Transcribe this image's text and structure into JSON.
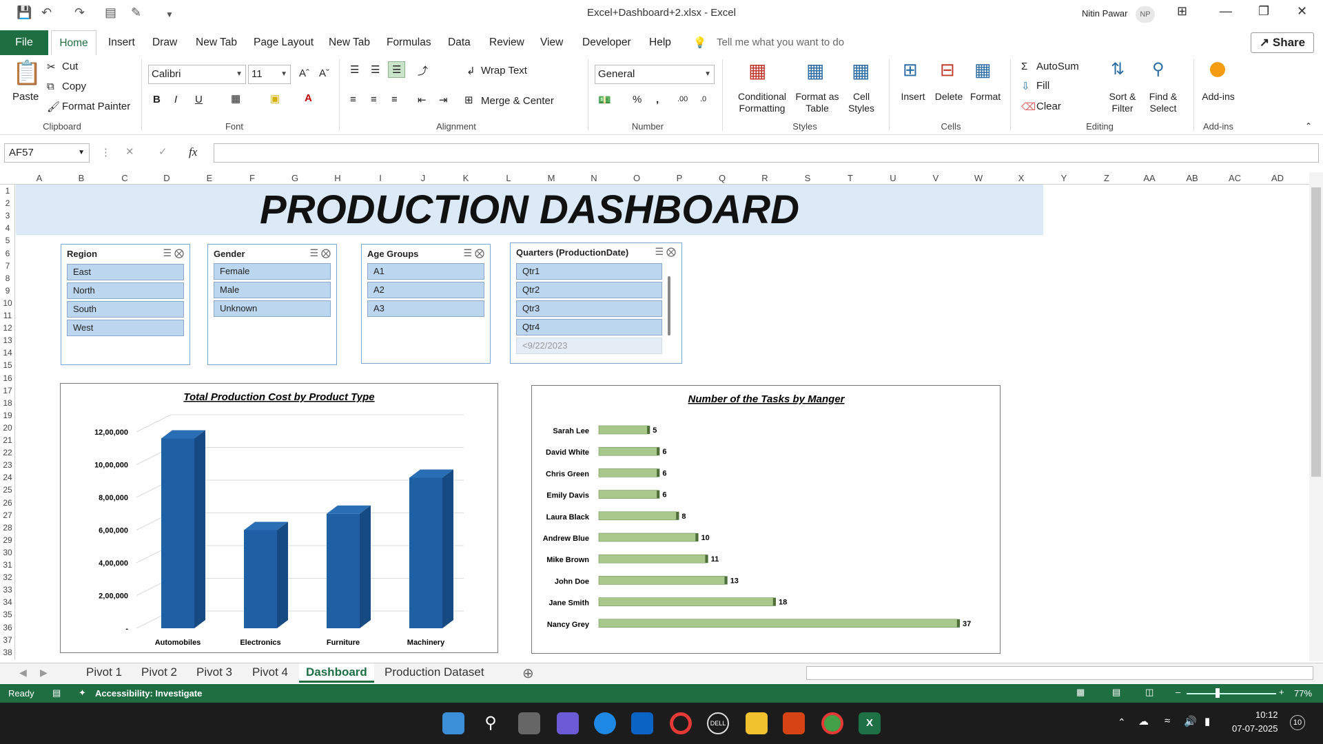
{
  "window": {
    "title": "Excel+Dashboard+2.xlsx  -  Excel",
    "user_name": "Nitin Pawar",
    "user_initials": "NP"
  },
  "tabs": {
    "file": "File",
    "items": [
      "Home",
      "Insert",
      "Draw",
      "New Tab",
      "Page Layout",
      "New Tab",
      "Formulas",
      "Data",
      "Review",
      "View",
      "Developer",
      "Help"
    ],
    "tell_me": "Tell me what you want to do",
    "share": "Share"
  },
  "ribbon": {
    "clipboard": {
      "paste": "Paste",
      "cut": "Cut",
      "copy": "Copy",
      "format_painter": "Format Painter",
      "label": "Clipboard"
    },
    "font": {
      "name": "Calibri",
      "size": "11",
      "label": "Font"
    },
    "alignment": {
      "wrap": "Wrap Text",
      "merge": "Merge & Center",
      "label": "Alignment"
    },
    "number": {
      "format": "General",
      "label": "Number"
    },
    "styles": {
      "conditional": [
        "Conditional",
        "Formatting"
      ],
      "format_table": [
        "Format as",
        "Table"
      ],
      "cell_styles": [
        "Cell",
        "Styles"
      ],
      "label": "Styles"
    },
    "cells": {
      "insert": "Insert",
      "delete": "Delete",
      "format": "Format",
      "label": "Cells"
    },
    "editing": {
      "autosum": "AutoSum",
      "fill": "Fill",
      "clear": "Clear",
      "sort": [
        "Sort &",
        "Filter"
      ],
      "find": [
        "Find &",
        "Select"
      ],
      "label": "Editing"
    },
    "addins": {
      "button": "Add-ins",
      "label": "Add-ins"
    }
  },
  "formula_bar": {
    "name_box": "AF57",
    "fx": "fx",
    "value": ""
  },
  "columns": [
    "A",
    "B",
    "C",
    "D",
    "E",
    "F",
    "G",
    "H",
    "I",
    "J",
    "K",
    "L",
    "M",
    "N",
    "O",
    "P",
    "Q",
    "R",
    "S",
    "T",
    "U",
    "V",
    "W",
    "X",
    "Y",
    "Z",
    "AA",
    "AB",
    "AC",
    "AD"
  ],
  "rows": [
    "1",
    "2",
    "3",
    "4",
    "5",
    "6",
    "7",
    "8",
    "9",
    "10",
    "11",
    "12",
    "13",
    "14",
    "15",
    "16",
    "17",
    "18",
    "19",
    "20",
    "21",
    "22",
    "23",
    "24",
    "25",
    "26",
    "27",
    "28",
    "29",
    "30",
    "31",
    "32",
    "33",
    "34",
    "35",
    "36",
    "37",
    "38"
  ],
  "dashboard": {
    "title": "PRODUCTION DASHBOARD"
  },
  "slicers": {
    "region": {
      "title": "Region",
      "items": [
        "East",
        "North",
        "South",
        "West"
      ]
    },
    "gender": {
      "title": "Gender",
      "items": [
        "Female",
        "Male",
        "Unknown"
      ]
    },
    "age": {
      "title": "Age Groups",
      "items": [
        "A1",
        "A2",
        "A3"
      ]
    },
    "quarters": {
      "title": "Quarters (ProductionDate)",
      "items": [
        "Qtr1",
        "Qtr2",
        "Qtr3",
        "Qtr4"
      ],
      "nodata_item": "<9/22/2023"
    }
  },
  "chart_data": [
    {
      "type": "bar",
      "title": "Total Production Cost by Product Type",
      "categories": [
        "Automobiles",
        "Electronics",
        "Furniture",
        "Machinery"
      ],
      "values": [
        1160000,
        600000,
        700000,
        920000
      ],
      "ylim": [
        0,
        1200000
      ],
      "ytick_labels": [
        "-",
        "2,00,000",
        "4,00,000",
        "6,00,000",
        "8,00,000",
        "10,00,000",
        "12,00,000"
      ],
      "color": "#1f5fa3",
      "grid": true
    },
    {
      "type": "bar",
      "orientation": "horizontal",
      "title": "Number of the Tasks by Manger",
      "categories": [
        "Sarah Lee",
        "David White",
        "Chris Green",
        "Emily Davis",
        "Laura Black",
        "Andrew Blue",
        "Mike Brown",
        "John Doe",
        "Jane Smith",
        "Nancy Grey"
      ],
      "values": [
        5,
        6,
        6,
        6,
        8,
        10,
        11,
        13,
        18,
        37
      ],
      "color": "#a8c98b"
    }
  ],
  "sheet_tabs": {
    "items": [
      "Pivot 1",
      "Pivot 2",
      "Pivot 3",
      "Pivot 4",
      "Dashboard",
      "Production Dataset"
    ],
    "active": "Dashboard"
  },
  "status": {
    "ready": "Ready",
    "accessibility": "Accessibility: Investigate",
    "zoom": "77%"
  },
  "taskbar": {
    "time": "10:12",
    "date": "07-07-2025",
    "notifications": "10"
  }
}
